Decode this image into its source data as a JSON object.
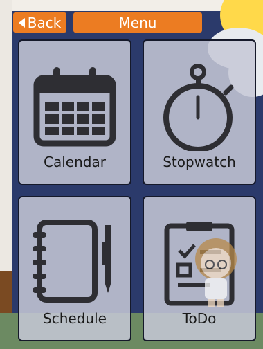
{
  "header": {
    "back_label": "Back",
    "title": "Menu"
  },
  "tiles": [
    {
      "label": "Calendar",
      "icon": "calendar-icon"
    },
    {
      "label": "Stopwatch",
      "icon": "stopwatch-icon"
    },
    {
      "label": "Schedule",
      "icon": "notebook-icon"
    },
    {
      "label": "ToDo",
      "icon": "todo-clipboard-icon"
    }
  ],
  "colors": {
    "accent": "#ec7c22",
    "night_sky": "#2b3a6b",
    "tile_bg": "#c6c8d6",
    "icon": "#2e2e33"
  }
}
